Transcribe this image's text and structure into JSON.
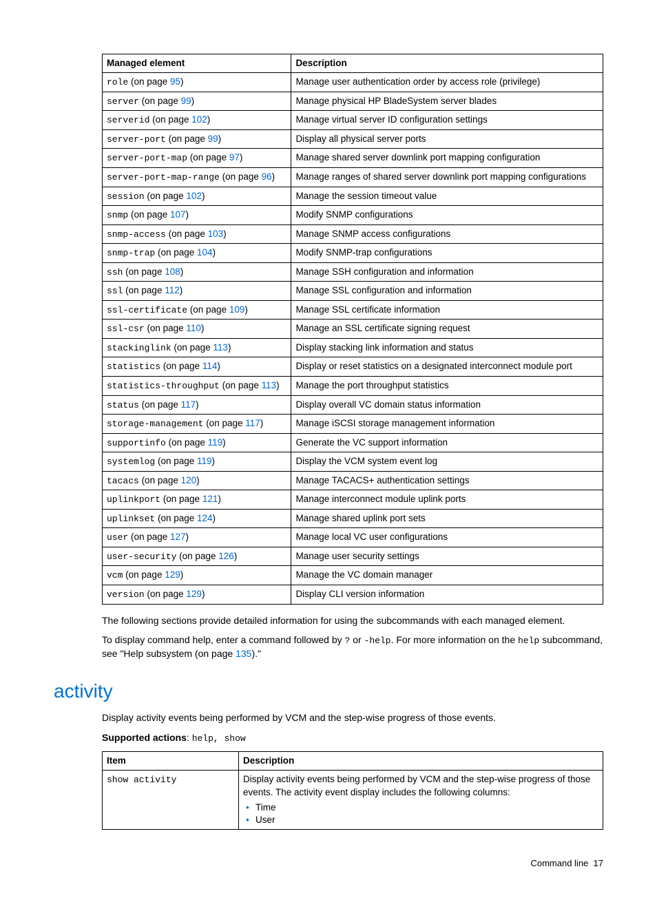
{
  "table1": {
    "headers": [
      "Managed element",
      "Description"
    ],
    "rows": [
      {
        "cmd": "role",
        "page": "95",
        "desc": "Manage user authentication order by access role (privilege)"
      },
      {
        "cmd": "server",
        "page": "99",
        "desc": "Manage physical HP BladeSystem server blades"
      },
      {
        "cmd": "serverid",
        "page": "102",
        "desc": "Manage virtual server ID configuration settings"
      },
      {
        "cmd": "server-port",
        "page": "99",
        "desc": "Display all physical server ports"
      },
      {
        "cmd": "server-port-map",
        "page": "97",
        "desc": "Manage shared server downlink port mapping configuration"
      },
      {
        "cmd": "server-port-map-range",
        "page": "96",
        "desc": "Manage ranges of shared server downlink port mapping configurations"
      },
      {
        "cmd": "session",
        "page": "102",
        "desc": "Manage the session timeout value"
      },
      {
        "cmd": "snmp",
        "page": "107",
        "desc": "Modify SNMP configurations"
      },
      {
        "cmd": "snmp-access",
        "page": "103",
        "desc": "Manage SNMP access configurations"
      },
      {
        "cmd": "snmp-trap",
        "page": "104",
        "desc": "Modify SNMP-trap configurations"
      },
      {
        "cmd": "ssh",
        "page": "108",
        "desc": "Manage SSH configuration and information"
      },
      {
        "cmd": "ssl",
        "page": "112",
        "desc": "Manage SSL configuration and information"
      },
      {
        "cmd": "ssl-certificate",
        "page": "109",
        "desc": "Manage SSL certificate information"
      },
      {
        "cmd": "ssl-csr",
        "page": "110",
        "desc": "Manage an SSL certificate signing request"
      },
      {
        "cmd": "stackinglink",
        "page": "113",
        "desc": "Display stacking link information and status"
      },
      {
        "cmd": "statistics",
        "page": "114",
        "desc": "Display or reset statistics on a designated interconnect module port"
      },
      {
        "cmd": "statistics-throughput",
        "page": "113",
        "desc": "Manage the port throughput statistics"
      },
      {
        "cmd": "status",
        "page": "117",
        "desc": "Display overall VC domain status information"
      },
      {
        "cmd": "storage-management",
        "page": "117",
        "desc": "Manage iSCSI storage management information"
      },
      {
        "cmd": "supportinfo",
        "page": "119",
        "desc": "Generate the VC support information"
      },
      {
        "cmd": "systemlog",
        "page": "119",
        "desc": "Display the VCM system event log"
      },
      {
        "cmd": "tacacs",
        "page": "120",
        "desc": "Manage TACACS+ authentication settings"
      },
      {
        "cmd": "uplinkport",
        "page": "121",
        "desc": "Manage interconnect module uplink ports"
      },
      {
        "cmd": "uplinkset",
        "page": "124",
        "desc": "Manage shared uplink port sets"
      },
      {
        "cmd": "user",
        "page": "127",
        "desc": "Manage local VC user configurations"
      },
      {
        "cmd": "user-security",
        "page": "126",
        "desc": "Manage user security settings"
      },
      {
        "cmd": "vcm",
        "page": "129",
        "desc": "Manage the VC domain manager"
      },
      {
        "cmd": "version",
        "page": "129",
        "desc": "Display CLI version information"
      }
    ]
  },
  "paragraphs": {
    "p1": "The following sections provide detailed information for using the subcommands with each managed element.",
    "p2a": "To display command help, enter a command followed by ",
    "p2b": "?",
    "p2c": " or ",
    "p2d": "-help",
    "p2e": ". For more information on the ",
    "p2f": "help",
    "p2g": " subcommand, see \"Help subsystem (on page ",
    "p2h": "135",
    "p2i": ").\""
  },
  "section": {
    "heading": "activity",
    "intro": "Display activity events being performed by VCM and the step-wise progress of those events.",
    "supported_label": "Supported actions",
    "supported_value": "help, show"
  },
  "table2": {
    "headers": [
      "Item",
      "Description"
    ],
    "row": {
      "item": "show activity",
      "desc": "Display activity events being performed by VCM and the step-wise progress of those events. The activity event display includes the following columns:",
      "bullets": [
        "Time",
        "User"
      ]
    }
  },
  "strings": {
    "on_page_open": " (on page ",
    "on_page_close": ")"
  },
  "footer": {
    "label": "Command line",
    "page": "17"
  }
}
